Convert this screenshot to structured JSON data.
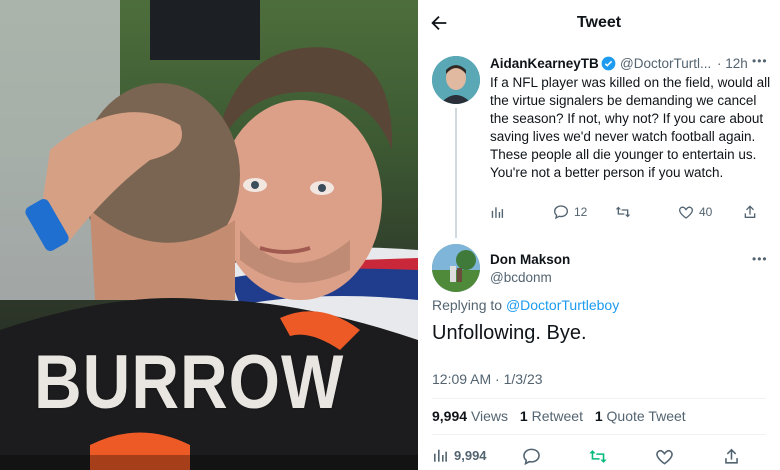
{
  "photo": {
    "jersey_name": "BURROW"
  },
  "header": {
    "title": "Tweet"
  },
  "main_tweet": {
    "display_name": "AidanKearneyTB",
    "handle": "@DoctorTurtl...",
    "time": "· 12h",
    "text": "If a NFL player was killed on the field, would all the virtue signalers be demanding we cancel the season? If not, why not? If you care about saving lives we'd never watch football again. These people all die younger to entertain us. You're not a better person if you watch.",
    "actions": {
      "replies": "12",
      "likes": "40"
    }
  },
  "reply_tweet": {
    "display_name": "Don Makson",
    "handle": "@bcdonm",
    "replying_label": "Replying to",
    "replying_handle": "@DoctorTurtleboy",
    "text": "Unfollowing. Bye.",
    "timestamp": "12:09 AM · 1/3/23",
    "stats": {
      "views_value": "9,994",
      "views_label": "Views",
      "retweets_value": "1",
      "retweets_label": "Retweet",
      "quotes_value": "1",
      "quotes_label": "Quote Tweet"
    },
    "actions": {
      "views": "9,994"
    }
  },
  "colors": {
    "accent": "#1d9bf0",
    "retweet_green": "#00ba7c",
    "secondary_text": "#536471"
  }
}
